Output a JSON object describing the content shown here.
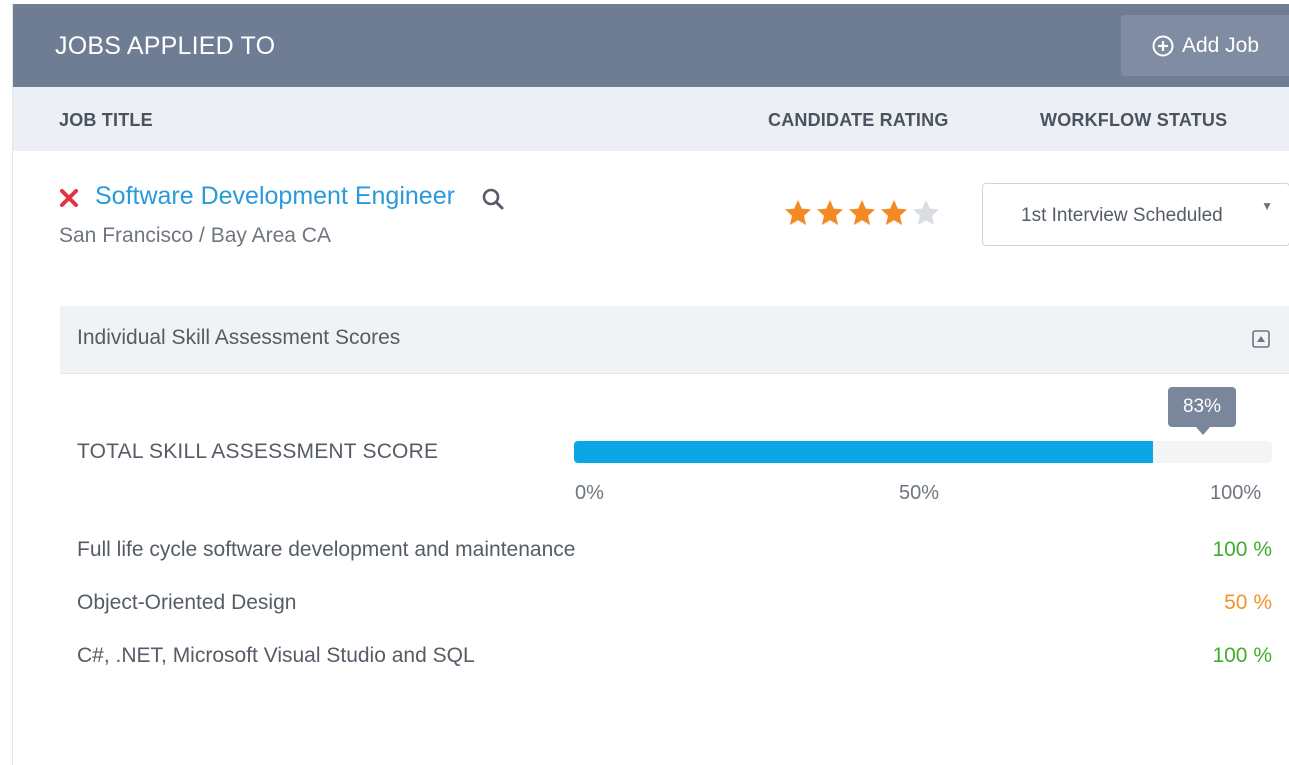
{
  "header": {
    "title": "JOBS APPLIED TO",
    "add_job_label": "Add Job"
  },
  "columns": {
    "job_title": "JOB TITLE",
    "candidate_rating": "CANDIDATE RATING",
    "workflow_status": "WORKFLOW STATUS"
  },
  "job": {
    "title": "Software Development Engineer",
    "location": "San Francisco / Bay Area CA",
    "rating": 4,
    "rating_max": 5,
    "workflow_status": "1st Interview Scheduled"
  },
  "assessment": {
    "title": "Individual Skill Assessment Scores",
    "total_label": "TOTAL SKILL ASSESSMENT SCORE",
    "total_value": 83,
    "total_display": "83%",
    "ticks": [
      "0%",
      "50%",
      "100%"
    ],
    "skills": [
      {
        "name": "Full life cycle software development and maintenance",
        "score": "100 %",
        "color": "#3fae2a"
      },
      {
        "name": "Object-Oriented Design",
        "score": "50 %",
        "color": "#f0932b"
      },
      {
        "name": "C#, .NET, Microsoft Visual Studio and SQL",
        "score": "100 %",
        "color": "#3fae2a"
      }
    ]
  },
  "colors": {
    "header_bg": "#6e7c94",
    "link": "#2a9bd8",
    "star_on": "#f58a25",
    "star_off": "#d9dde2",
    "bar": "#0aa6e6",
    "remove": "#e0343f"
  }
}
